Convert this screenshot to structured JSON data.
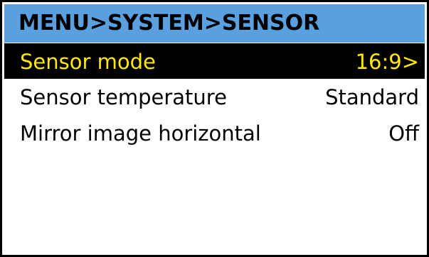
{
  "header": {
    "title": "MENU>SYSTEM>SENSOR"
  },
  "menu": {
    "items": [
      {
        "label": "Sensor mode",
        "value": "16:9>",
        "selected": true
      },
      {
        "label": "Sensor temperature",
        "value": "Standard",
        "selected": false
      },
      {
        "label": "Mirror image horizontal",
        "value": "Off",
        "selected": false
      }
    ]
  },
  "colors": {
    "header_bg": "#5aa0de",
    "selected_bg": "#000000",
    "selected_text": "#ffea00",
    "text": "#000000",
    "background": "#ffffff"
  }
}
